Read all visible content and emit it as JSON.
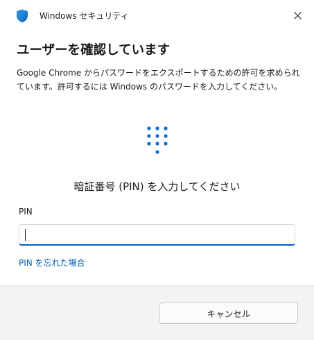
{
  "window": {
    "title": "Windows セキュリティ",
    "app_icon": "shield-icon",
    "close_icon": "close-icon",
    "accent_color": "#005fb8"
  },
  "main": {
    "heading": "ユーザーを確認しています",
    "description": "Google Chrome からパスワードをエクスポートするための許可を求められています。許可するには Windows のパスワードを入力してください。",
    "method_icon": "pin-keypad-icon",
    "prompt": "暗証番号 (PIN) を入力してください",
    "pin_label": "PIN",
    "pin_value": "",
    "forgot_link": "PIN を忘れた場合"
  },
  "footer": {
    "cancel_label": "キャンセル"
  }
}
